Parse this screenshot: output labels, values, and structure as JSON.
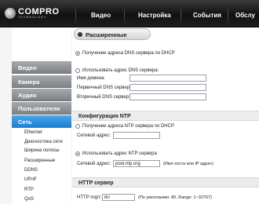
{
  "brand": {
    "name": "COMPRO",
    "sub": "TECHNOLOGY"
  },
  "nav": [
    "Видео",
    "Настройка",
    "События",
    "Обслу"
  ],
  "sidebar": {
    "captions": [
      "Видео",
      "Камера",
      "Аудио",
      "Пользователи",
      "Сеть"
    ],
    "items": [
      "Ethernet",
      "Диагностика сети",
      "Ширина полосы",
      "Расширенные",
      "DDNS",
      "UPnP",
      "RTP",
      "QoS"
    ]
  },
  "tab_title": "Расширенные",
  "dns": {
    "dhcp_label": "Получение адреса DNS сервера по DHCP",
    "use_label": "Использовать адрес DNS сервера:",
    "domain_label": "Имя домена:",
    "primary_label": "Первичный DNS сервер:",
    "secondary_label": "Вторичный DNS сервер:",
    "domain_value": "",
    "primary_value": "",
    "secondary_value": ""
  },
  "ntp": {
    "title": "Конфигурация NTP",
    "dhcp_label": "Получение адреса NTP сервера по DHCP",
    "addr_label": "Сетевой адрес:",
    "addr_value": "",
    "use_label": "Использовать адрес NTP сервера",
    "addr2_label": "Сетевой адрес:",
    "addr2_value": "pool.ntp.org",
    "hint": "(Имя хоста или IP адрес)"
  },
  "http": {
    "title": "HTTP сервер",
    "port_label": "HTTP порт:",
    "port_value": "80",
    "hint": "(По умолчанию: 80, Range: 1~32767)"
  }
}
